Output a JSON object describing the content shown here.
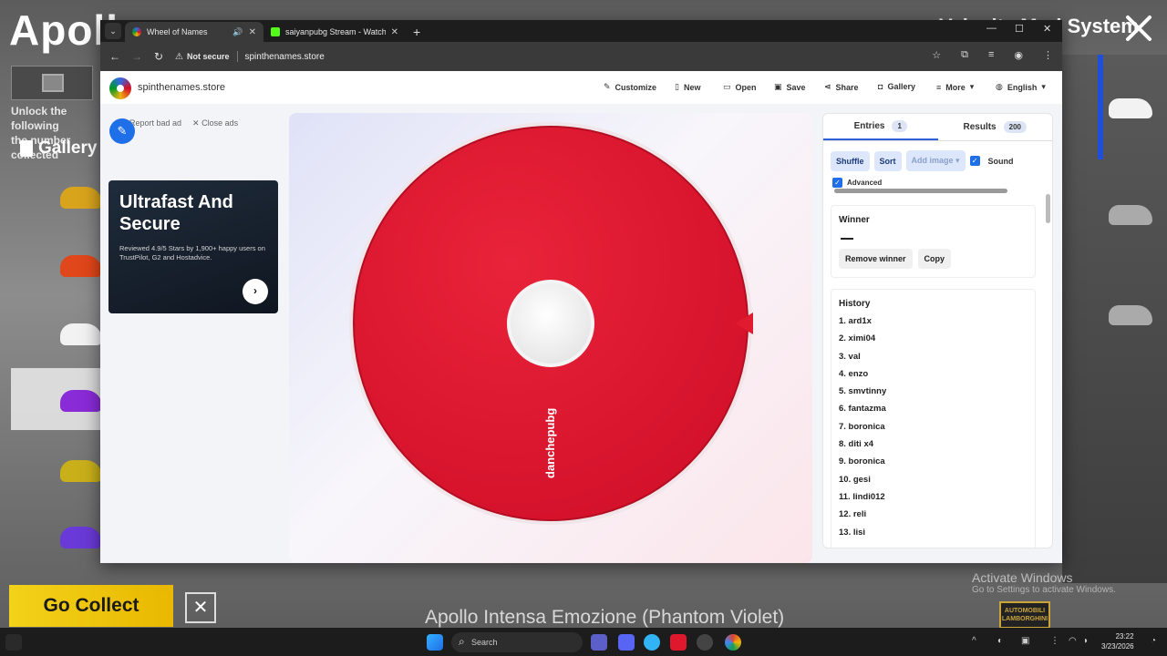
{
  "game": {
    "title": "Apollo",
    "right_title": "Velocita Mod System",
    "unlock_text": "Unlock the following",
    "unlock_text2": "the number collected",
    "gallery_label": "Gallery",
    "go_collect": "Go Collect",
    "caption": "Apollo Intensa Emozione (Phantom Violet)",
    "activate_title": "Activate Windows",
    "activate_sub": "Go to Settings to activate Windows.",
    "brand_logo": "AUTOMOBILI LAMBORGHINI"
  },
  "browser": {
    "tabs": [
      {
        "label": "Wheel of Names",
        "active": true,
        "favicon_color": "#3369e8"
      },
      {
        "label": "saiyanpubg Stream - Watch Live",
        "active": false,
        "favicon_color": "#53fc18"
      }
    ],
    "address": {
      "security": "Not secure",
      "url": "spinthenames.store"
    }
  },
  "site": {
    "name": "spinthenames.store",
    "menu": [
      {
        "icon": "palette-icon",
        "label": "Customize"
      },
      {
        "icon": "file-icon",
        "label": "New"
      },
      {
        "icon": "folder-icon",
        "label": "Open"
      },
      {
        "icon": "save-icon",
        "label": "Save"
      },
      {
        "icon": "share-icon",
        "label": "Share"
      },
      {
        "icon": "camera-icon",
        "label": "Gallery"
      },
      {
        "icon": "menu-icon",
        "label": "More"
      },
      {
        "icon": "globe-icon",
        "label": "English"
      }
    ],
    "ad": {
      "report": "Report bad ad",
      "close": "Close ads",
      "headline": "Ultrafast And Secure",
      "body": "Reviewed 4.9/5 Stars by 1,900+ happy users on TrustPilot, G2 and Hostadvice."
    },
    "wheel": {
      "segment_label": "danchepubg",
      "color": "#e01a2f",
      "pointer_color": "#e01a2f"
    },
    "panel": {
      "entries_label": "Entries",
      "entries_count": "1",
      "results_label": "Results",
      "results_count": "200",
      "shuffle": "Shuffle",
      "sort": "Sort",
      "add_image": "Add image",
      "sound": "Sound",
      "advanced": "Advanced",
      "winner_title": "Winner",
      "winner_value": "—",
      "remove_winner": "Remove winner",
      "copy": "Copy",
      "history_title": "History",
      "history": [
        "1. ard1x",
        "2. ximi04",
        "3. val",
        "4. enzo",
        "5. smvtinny",
        "6. fantazma",
        "7. boronica",
        "8. diti x4",
        "9. boronica",
        "10. gesi",
        "11. lindi012",
        "12. reli",
        "13. lisi"
      ]
    }
  },
  "taskbar": {
    "search_placeholder": "Search",
    "time": "23:22",
    "date": "3/23/2026"
  }
}
